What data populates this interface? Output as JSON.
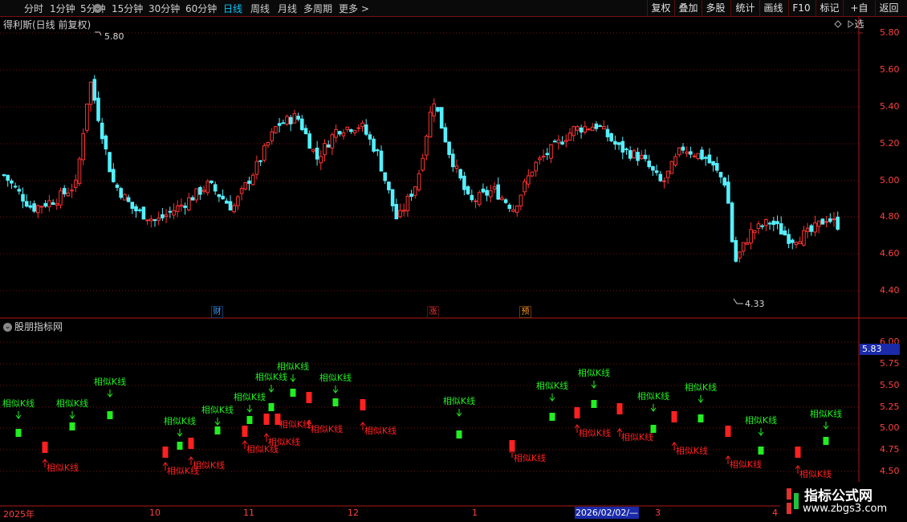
{
  "toolbar": {
    "periods": [
      "分时",
      "1分钟",
      "5分钟",
      "15分钟",
      "30分钟",
      "60分钟",
      "日线",
      "周线",
      "月线",
      "多周期",
      "更多 >"
    ],
    "active_index": 6,
    "buttons": [
      "复权",
      "叠加",
      "多股",
      "统计",
      "画线",
      "F10",
      "标记",
      "+自选",
      "返回"
    ]
  },
  "main_title": "得利斯(日线 前复权)",
  "indicator_title": "股朋指标网",
  "main_axis": {
    "labels": [
      "5.80",
      "5.60",
      "5.40",
      "5.20",
      "5.00",
      "4.80",
      "4.60",
      "4.40"
    ]
  },
  "ind_axis": {
    "labels": [
      "6.00",
      "5.75",
      "5.50",
      "5.25",
      "5.00",
      "4.75",
      "4.50"
    ],
    "current": "5.83"
  },
  "annotations": {
    "high": "5.80",
    "low": "4.33"
  },
  "badges": [
    {
      "text": "财",
      "color": "#3aa0ff"
    },
    {
      "text": "涨",
      "color": "#ff3030"
    },
    {
      "text": "预",
      "color": "#ff9a20"
    }
  ],
  "x_axis": {
    "labels": [
      "2025年",
      "10",
      "11",
      "12",
      "1",
      "3",
      "4"
    ],
    "cursor_date": "2026/02/02/—"
  },
  "signal_label": "相似K线",
  "watermark": {
    "line1": "指标公式网",
    "line2": "www.zbgs3.com"
  },
  "colors": {
    "up": "#ff3333",
    "down": "#55f0ff",
    "buy": "#ff2020",
    "sell": "#22ee22",
    "grid": "#7a1010"
  }
}
